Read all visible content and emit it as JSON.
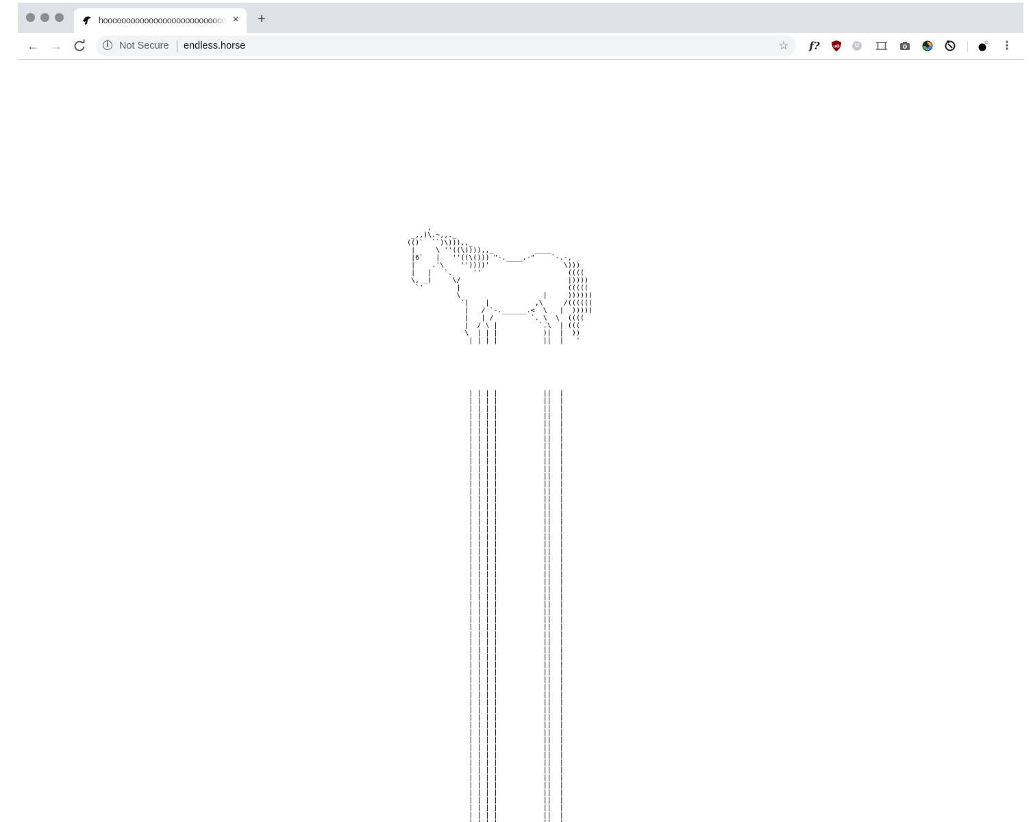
{
  "browser": {
    "tab": {
      "title": "hoooooooooooooooooooooooooooooooooooooooooooooooooooooooooooooooooooooooooooooooooooooooooooooooooooorse",
      "close_label": "×",
      "favicon": "horse-icon"
    },
    "new_tab_label": "+",
    "nav": {
      "back_label": "←",
      "forward_label": "→",
      "reload_label": "C"
    },
    "omnibox": {
      "security_label": "Not Secure",
      "url": "endless.horse"
    },
    "extensions": {
      "fquestion_label": "f?"
    },
    "menu_label": "⋮"
  },
  "page": {
    "horse_art": "          ,\n      _,,)\\.~,,._\n     (()`  ``)\\))),,_\n      |     \\ ''((\\)))),,_          ____\n      |6`   |   ''((\\())) \"-.____.-\"    `-.-,\n      |    .'\\    ''))))'                  \\)))\n      |   |   `.     ''                     ((((\n      \\, _)     \\/                          |))))\n       `'        |                          (((((\n                 \\                    |     ))))))\n                  `|    |           ,\\     /((((((\n                   |   / `-.______.<  \\   |  )))))\n                   |   | /         `. \\  \\  ((((\n                   |  / \\ |          `.\\  | (((\n                   \\  | | |           )|  |  ))\n                    | | | |           ||  |   '",
    "leg_line": "                    | | | |           ||  |"
  },
  "colors": {
    "tabstrip_bg": "#dee1e6",
    "omnibox_bg": "#f1f3f4",
    "ublock_red": "#800000",
    "text": "#202124"
  }
}
